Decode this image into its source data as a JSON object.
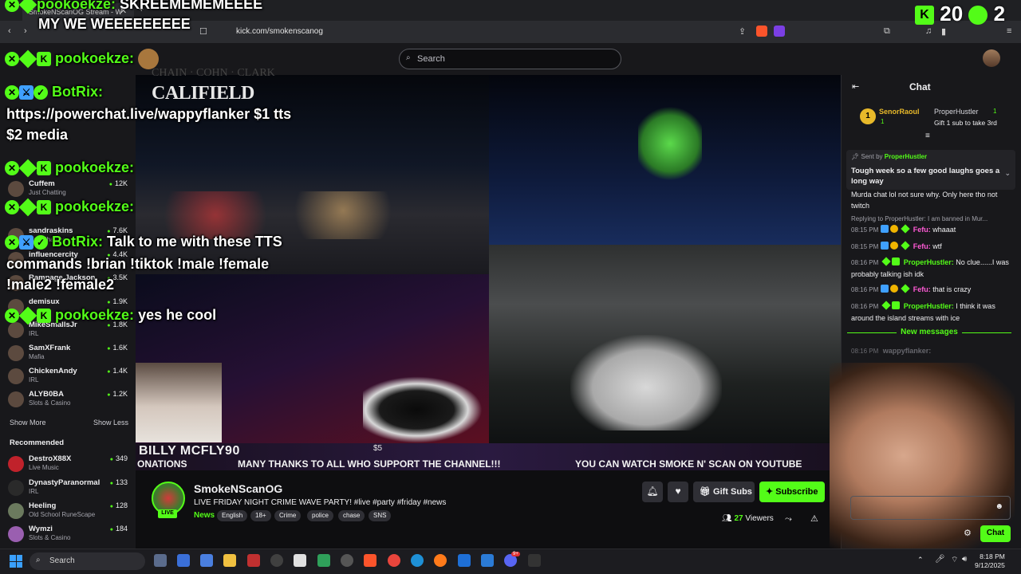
{
  "browser": {
    "tab_title": "SmokeNScanOG Stream - W",
    "url": "kick.com/smokenscanog"
  },
  "header": {
    "search_placeholder": "Search"
  },
  "sidebar": {
    "following": [
      {
        "name": "Cuffem",
        "category": "Just Chatting",
        "viewers": "12K"
      },
      {
        "name": "sandraskins",
        "category": "Just Chatting",
        "viewers": "7.6K"
      },
      {
        "name": "influencercity",
        "category": "",
        "viewers": "4.4K"
      },
      {
        "name": "Rampage Jackson",
        "category": "",
        "viewers": "3.5K"
      },
      {
        "name": "demisux",
        "category": "",
        "viewers": "1.9K"
      },
      {
        "name": "MikeSmallsJr",
        "category": "IRL",
        "viewers": "1.8K"
      },
      {
        "name": "SamXFrank",
        "category": "Mafia",
        "viewers": "1.6K"
      },
      {
        "name": "ChickenAndy",
        "category": "IRL",
        "viewers": "1.4K"
      },
      {
        "name": "ALYB0BA",
        "category": "Slots & Casino",
        "viewers": "1.2K"
      }
    ],
    "show_more": "Show More",
    "show_less": "Show Less",
    "recommended_label": "Recommended",
    "recommended": [
      {
        "name": "DestroX88X",
        "category": "Live Music",
        "viewers": "349"
      },
      {
        "name": "DynastyParanormal",
        "category": "IRL",
        "viewers": "133"
      },
      {
        "name": "Heeling",
        "category": "Old School RuneScape",
        "viewers": "128"
      },
      {
        "name": "Wymzi",
        "category": "Slots & Casino",
        "viewers": "184"
      }
    ]
  },
  "overlay_chat": {
    "line1_user": "pookoekze:",
    "line1_msg": "SKREEMEMEMEEEE",
    "line2": "MY WE WEEEEEEEEE",
    "line3_user": "pookoekze:",
    "line4_user": "BotRix:",
    "line4_msg1": "https://powerchat.live/wappyflanker $1 tts",
    "line4_msg2": "$2 media",
    "line5_user": "pookoekze:",
    "line6_user": "pookoekze:",
    "line7_user": "BotRix:",
    "line7_msg1": "Talk to me with these TTS",
    "line7_msg2": "commands !brian !tiktok !male !female",
    "line7_msg3": "!male2 !female2",
    "line8_user": "pookoekze:",
    "line8_msg": "yes he cool",
    "score_a": "20",
    "score_b": "2"
  },
  "video": {
    "califield": "CALIFIELD",
    "califield_sub": "CHAIN · COHN · CLARK",
    "lower_name": "BILLY MCFLY90",
    "lower_amount": "$5",
    "ticker1": "ONATIONS",
    "ticker2": "MANY THANKS TO ALL WHO SUPPORT THE CHANNEL!!!",
    "ticker3": "YOU CAN WATCH SMOKE N' SCAN ON YOUTUBE"
  },
  "channel": {
    "name": "SmokeNScanOG",
    "title": "LIVE FRIDAY NIGHT CRIME WAVE PARTY! #live #party #friday #news",
    "category": "News",
    "tags": [
      "English",
      "18+",
      "Crime",
      "police",
      "chase",
      "SNS"
    ],
    "live_label": "LIVE",
    "gift_label": "Gift Subs",
    "subscribe_label": "Subscribe",
    "viewers_count": "27",
    "viewers_label": "Viewers"
  },
  "chat": {
    "title": "Chat",
    "gifter": {
      "name": "SenorRaoul",
      "count": "1",
      "rank": "1"
    },
    "gift_top": {
      "name": "ProperHustler",
      "count": "1",
      "text": "Gift 1 sub to take 3rd"
    },
    "pinned_sent_by_label": "Sent by",
    "pinned_sender": "ProperHustler",
    "pinned_text": "Tough week so a few good laughs goes a long way",
    "messages": [
      {
        "time": "",
        "user": "",
        "text": "Murda chat lol not sure why. Only here tho not twitch"
      },
      {
        "time": "",
        "user": "",
        "text": "Replying to ProperHustler: I am banned in Mur..."
      },
      {
        "time": "08:15 PM",
        "user": "Fefu:",
        "text": "whaaat"
      },
      {
        "time": "08:15 PM",
        "user": "Fefu:",
        "text": "wtf"
      },
      {
        "time": "08:16 PM",
        "user": "ProperHustler:",
        "text": "No clue......I was probably talking ish idk"
      },
      {
        "time": "08:16 PM",
        "user": "Fefu:",
        "text": "that is crazy"
      },
      {
        "time": "08:16 PM",
        "user": "ProperHustler:",
        "text": "I think it was around the island streams with ice"
      },
      {
        "time": "08:16 PM",
        "user": "wappyflanker:",
        "text": ""
      }
    ],
    "new_messages": "New messages",
    "chat_button": "Chat"
  },
  "taskbar": {
    "search_placeholder": "Search",
    "time": "8:18 PM",
    "date": "9/12/2025",
    "badge_count": "9+"
  }
}
